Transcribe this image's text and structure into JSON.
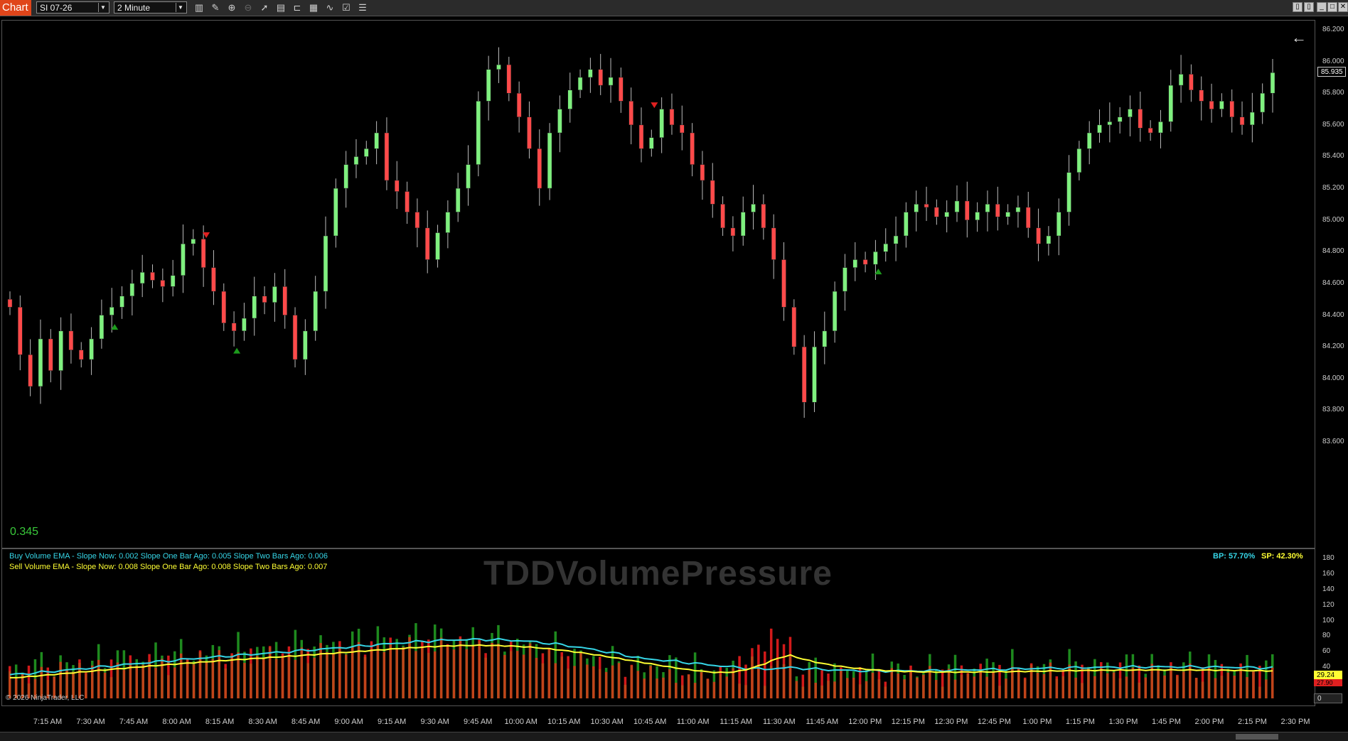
{
  "toolbar": {
    "app_label": "Chart",
    "instrument": "SI 07-26",
    "interval": "2 Minute",
    "icons": [
      "bar-type-icon",
      "draw-icon",
      "zoom-in-icon",
      "zoom-out-icon",
      "pointer-icon",
      "data-box-icon",
      "properties-icon",
      "strategy-icon",
      "indicator-icon",
      "templates-icon",
      "list-icon"
    ]
  },
  "price_axis": {
    "labels": [
      "86.200",
      "86.000",
      "85.800",
      "85.600",
      "85.400",
      "85.200",
      "85.000",
      "84.800",
      "84.600",
      "84.400",
      "84.200",
      "84.000",
      "83.800",
      "83.600"
    ],
    "last_price": "85.935",
    "min": 83.6,
    "max": 86.2
  },
  "main_panel": {
    "corner_value": "0.345",
    "back_arrow": "←"
  },
  "indicator": {
    "name": "TDDVolumePressure",
    "buy_legend": "Buy Volume EMA - Slope Now: 0.002   Slope One Bar Ago: 0.005   Slope Two Bars Ago: 0.006",
    "sell_legend": "Sell Volume EMA - Slope Now: 0.008   Slope One Bar Ago: 0.008   Slope Two Bars Ago: 0.007",
    "bp_label": "BP: 57.70%",
    "sp_label": "SP: 42.30%",
    "axis_labels": [
      "180",
      "160",
      "140",
      "120",
      "100",
      "80",
      "60",
      "40",
      "20",
      "0"
    ],
    "value_tag_1": "29.24",
    "value_tag_2": "27.90",
    "zero_tag": "0",
    "copyright": "© 2026 NinjaTrader, LLC",
    "buy_color": "#36d6e7",
    "sell_color": "#ffff33"
  },
  "time_axis": [
    "7:15 AM",
    "7:30 AM",
    "7:45 AM",
    "8:00 AM",
    "8:15 AM",
    "8:30 AM",
    "8:45 AM",
    "9:00 AM",
    "9:15 AM",
    "9:30 AM",
    "9:45 AM",
    "10:00 AM",
    "10:15 AM",
    "10:30 AM",
    "10:45 AM",
    "11:00 AM",
    "11:15 AM",
    "11:30 AM",
    "11:45 AM",
    "12:00 PM",
    "12:15 PM",
    "12:30 PM",
    "12:45 PM",
    "1:00 PM",
    "1:15 PM",
    "1:30 PM",
    "1:45 PM",
    "2:00 PM",
    "2:15 PM",
    "2:30 PM"
  ],
  "colors": {
    "up_candle": "#7ff07f",
    "down_candle": "#ff4a4a",
    "app_accent": "#e0451a"
  },
  "chart_data": {
    "type": "candlestick",
    "closes": [
      84.45,
      84.15,
      83.95,
      84.25,
      84.05,
      84.3,
      84.18,
      84.12,
      84.25,
      84.4,
      84.45,
      84.52,
      84.6,
      84.67,
      84.62,
      84.58,
      84.65,
      84.85,
      84.88,
      84.7,
      84.55,
      84.35,
      84.3,
      84.38,
      84.52,
      84.48,
      84.58,
      84.4,
      84.12,
      84.3,
      84.55,
      84.9,
      85.2,
      85.35,
      85.4,
      85.45,
      85.55,
      85.25,
      85.18,
      85.05,
      84.95,
      84.75,
      84.92,
      85.05,
      85.2,
      85.35,
      85.75,
      85.95,
      85.98,
      85.8,
      85.65,
      85.45,
      85.2,
      85.55,
      85.7,
      85.82,
      85.9,
      85.95,
      85.85,
      85.9,
      85.75,
      85.6,
      85.45,
      85.52,
      85.7,
      85.6,
      85.55,
      85.35,
      85.25,
      85.1,
      84.95,
      84.9,
      85.05,
      85.1,
      84.95,
      84.75,
      84.45,
      84.2,
      83.85,
      84.2,
      84.3,
      84.55,
      84.7,
      84.75,
      84.72,
      84.8,
      84.85,
      84.9,
      85.05,
      85.1,
      85.08,
      85.02,
      85.05,
      85.12,
      85.0,
      85.05,
      85.1,
      85.02,
      85.05,
      85.08,
      84.95,
      84.85,
      84.9,
      85.05,
      85.3,
      85.45,
      85.55,
      85.6,
      85.62,
      85.65,
      85.7,
      85.58,
      85.55,
      85.62,
      85.85,
      85.92,
      85.82,
      85.75,
      85.7,
      85.75,
      85.65,
      85.6,
      85.68,
      85.8,
      85.93
    ]
  }
}
